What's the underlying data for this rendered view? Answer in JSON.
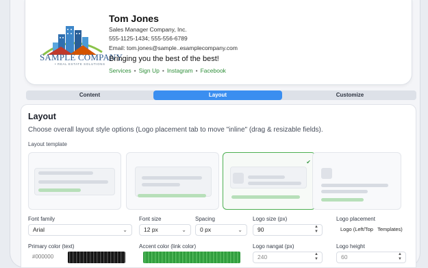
{
  "signature": {
    "name": "Tom Jones",
    "title": "Sales  Manager Company, Inc.",
    "phone": "555-1125-1434; 555-556-6789",
    "email": "Email: tom.jones@sample..esamplecompany.com",
    "tagline": "Bringing you the best of the best!",
    "links": [
      "Services",
      "Sign Up",
      "Instagram",
      "Facebook"
    ],
    "logo_text": "SAMPLE COMPANY",
    "logo_sub": "• REAL ESTATE SOLUTIONS"
  },
  "tabs": [
    {
      "label": "Content",
      "active": false
    },
    {
      "label": "Layout",
      "active": true
    },
    {
      "label": "Customize",
      "active": false
    }
  ],
  "layout": {
    "title": "Layout",
    "description": "Choose overall layout style options (Logo placement tab to move \"inline\" (drag & resizable fields).",
    "template_label": "Layout template",
    "selected_template": 3
  },
  "fields": {
    "font_family": {
      "label": "Font family",
      "value": "Arial"
    },
    "font_size": {
      "label": "Font size",
      "value": "12 px"
    },
    "spacing": {
      "label": "Spacing",
      "value": "0 px"
    },
    "logo_size": {
      "label": "Logo size (px)",
      "value": "90"
    },
    "logo_placement": {
      "label": "Logo placement",
      "value": "Logo (Left/Top   Templates)"
    },
    "primary_color": {
      "label": "Primary color (text)",
      "value": "#000000"
    },
    "accent_color": {
      "label": "Accent color (link color)",
      "value": ""
    },
    "logo_margin": {
      "label": "Logo nangat (px)",
      "value": "240"
    },
    "logo_height": {
      "label": "Logo height",
      "value": "60"
    }
  },
  "colors": {
    "accent": "#3a8ef0",
    "link_green": "#2f8f3a",
    "selected_border": "#4caf50"
  }
}
